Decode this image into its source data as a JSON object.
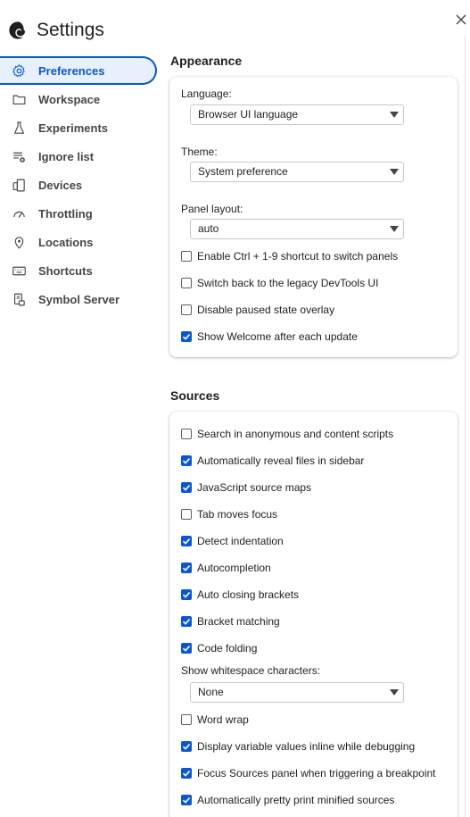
{
  "header": {
    "title": "Settings"
  },
  "sidebar": {
    "items": [
      {
        "label": "Preferences",
        "icon": "gear-icon",
        "active": true
      },
      {
        "label": "Workspace",
        "icon": "folder-icon"
      },
      {
        "label": "Experiments",
        "icon": "flask-icon"
      },
      {
        "label": "Ignore list",
        "icon": "ignore-list-icon"
      },
      {
        "label": "Devices",
        "icon": "devices-icon"
      },
      {
        "label": "Throttling",
        "icon": "speedometer-icon"
      },
      {
        "label": "Locations",
        "icon": "location-pin-icon"
      },
      {
        "label": "Shortcuts",
        "icon": "keyboard-icon"
      },
      {
        "label": "Symbol Server",
        "icon": "symbol-server-icon"
      }
    ]
  },
  "appearance": {
    "title": "Appearance",
    "language_label": "Language:",
    "language_value": "Browser UI language",
    "theme_label": "Theme:",
    "theme_value": "System preference",
    "panel_layout_label": "Panel layout:",
    "panel_layout_value": "auto",
    "checkboxes": [
      {
        "label": "Enable Ctrl + 1-9 shortcut to switch panels",
        "checked": false
      },
      {
        "label": "Switch back to the legacy DevTools UI",
        "checked": false
      },
      {
        "label": "Disable paused state overlay",
        "checked": false
      },
      {
        "label": "Show Welcome after each update",
        "checked": true
      }
    ]
  },
  "sources": {
    "title": "Sources",
    "checkboxes_a": [
      {
        "label": "Search in anonymous and content scripts",
        "checked": false
      },
      {
        "label": "Automatically reveal files in sidebar",
        "checked": true
      },
      {
        "label": "JavaScript source maps",
        "checked": true
      },
      {
        "label": "Tab moves focus",
        "checked": false
      },
      {
        "label": "Detect indentation",
        "checked": true
      },
      {
        "label": "Autocompletion",
        "checked": true
      },
      {
        "label": "Auto closing brackets",
        "checked": true
      },
      {
        "label": "Bracket matching",
        "checked": true
      },
      {
        "label": "Code folding",
        "checked": true
      }
    ],
    "whitespace_label": "Show whitespace characters:",
    "whitespace_value": "None",
    "checkboxes_b": [
      {
        "label": "Word wrap",
        "checked": false
      },
      {
        "label": "Display variable values inline while debugging",
        "checked": true
      },
      {
        "label": "Focus Sources panel when triggering a breakpoint",
        "checked": true
      },
      {
        "label": "Automatically pretty print minified sources",
        "checked": true
      }
    ]
  },
  "colors": {
    "accent": "#0b57d0",
    "active_bg": "#e8f0fe"
  }
}
